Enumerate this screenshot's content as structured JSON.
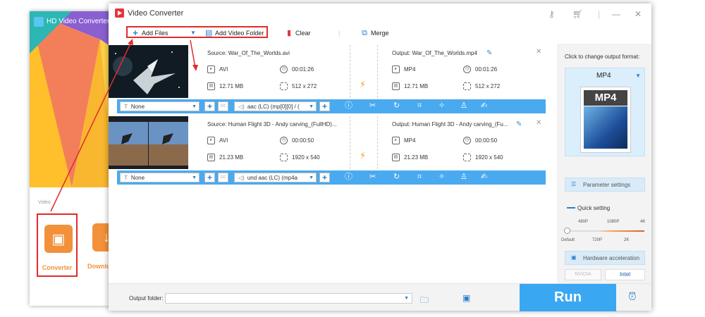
{
  "background_window": {
    "title": "HD Video Converter F",
    "section_label": "Video",
    "tools": [
      {
        "label": "Converter",
        "icon": "film-icon"
      },
      {
        "label": "Downlo",
        "icon": "download-icon"
      }
    ]
  },
  "window": {
    "title": "Video Converter"
  },
  "toolbar": {
    "add_files": "Add Files",
    "add_video_folder": "Add Video Folder",
    "clear": "Clear",
    "merge": "Merge"
  },
  "items": [
    {
      "source": "Source: War_Of_The_Worlds.avi",
      "output": "Output: War_Of_The_Worlds.mp4",
      "src_format": "AVI",
      "src_duration": "00:01:26",
      "src_size": "12.71 MB",
      "src_resolution": "512 x 272",
      "out_format": "MP4",
      "out_duration": "00:01:26",
      "out_size": "12.71 MB",
      "out_resolution": "512 x 272",
      "subtitle": "None",
      "audio": "aac (LC) (mp[0][0] / (",
      "thumb_style": "space"
    },
    {
      "source": "Source: Human Flight 3D - Andy carving_(FullHD)...",
      "output": "Output: Human Flight 3D - Andy carving_(Fu...",
      "src_format": "AVI",
      "src_duration": "00:00:50",
      "src_size": "21.23 MB",
      "src_resolution": "1920 x 540",
      "out_format": "MP4",
      "out_duration": "00:00:50",
      "out_size": "21.23 MB",
      "out_resolution": "1920 x 540",
      "subtitle": "None",
      "audio": "und aac (LC) (mp4a",
      "thumb_style": "sky"
    }
  ],
  "right_panel": {
    "caption": "Click to change output format:",
    "format": "MP4",
    "format_card": "MP4",
    "parameter_settings": "Parameter settings",
    "quick_setting": "Quick setting",
    "ticks_top": [
      "480P",
      "1080P",
      "4K"
    ],
    "ticks_bottom": [
      "Default",
      "720P",
      "2K"
    ],
    "hardware_acceleration": "Hardware acceleration",
    "nvidia": "NVIDIA",
    "intel": "Intel"
  },
  "bottom": {
    "output_folder_label": "Output folder:",
    "output_folder_value": "",
    "run": "Run"
  },
  "colors": {
    "accent": "#39a7f2",
    "bar": "#49aaf0",
    "orange": "#f3913a",
    "annotation_red": "#e12b2b"
  }
}
